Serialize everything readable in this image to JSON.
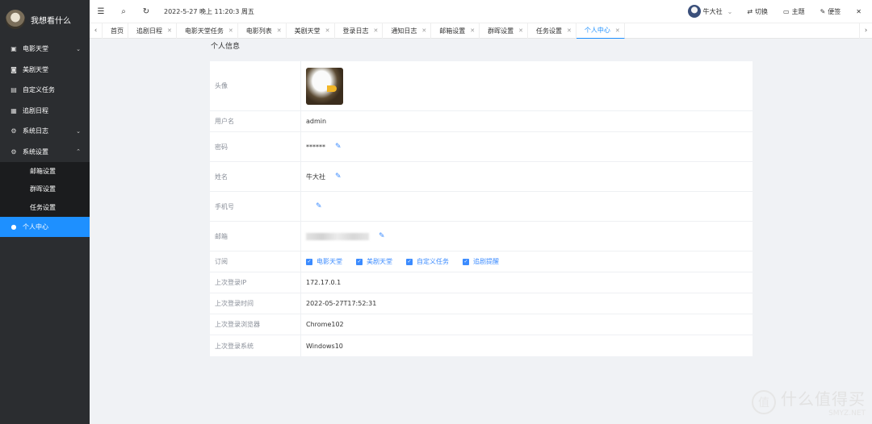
{
  "app": {
    "title": "我想看什么"
  },
  "sidebar": {
    "items": [
      {
        "label": "电影天堂",
        "icon": "film-icon",
        "chevron": "⌄"
      },
      {
        "label": "美剧天堂",
        "icon": "tv-icon",
        "chevron": ""
      },
      {
        "label": "自定义任务",
        "icon": "clipboard-icon",
        "chevron": ""
      },
      {
        "label": "追剧日程",
        "icon": "calendar-icon",
        "chevron": ""
      },
      {
        "label": "系统日志",
        "icon": "gear-icon",
        "chevron": "⌄"
      },
      {
        "label": "系统设置",
        "icon": "gear-icon",
        "chevron": "⌃"
      }
    ],
    "subitems": [
      {
        "label": "邮箱设置"
      },
      {
        "label": "群晖设置"
      },
      {
        "label": "任务设置"
      }
    ],
    "active": {
      "label": "个人中心",
      "icon": "user-icon"
    }
  },
  "topbar": {
    "menu_icon": "☰",
    "search_icon": "⌕",
    "refresh_icon": "↻",
    "datetime": "2022-5-27 晚上 11:20:3 周五",
    "user": "牛大社",
    "actions": {
      "switch": "切换",
      "theme": "主题",
      "notes": "便签"
    }
  },
  "tabs": [
    {
      "label": "首页",
      "closable": false
    },
    {
      "label": "追剧日程",
      "closable": true
    },
    {
      "label": "电影天堂任务",
      "closable": true
    },
    {
      "label": "电影列表",
      "closable": true
    },
    {
      "label": "美剧天堂",
      "closable": true
    },
    {
      "label": "登录日志",
      "closable": true
    },
    {
      "label": "通知日志",
      "closable": true
    },
    {
      "label": "邮箱设置",
      "closable": true
    },
    {
      "label": "群晖设置",
      "closable": true
    },
    {
      "label": "任务设置",
      "closable": true
    },
    {
      "label": "个人中心",
      "closable": true,
      "active": true
    }
  ],
  "page": {
    "title": "个人信息",
    "avatar_label": "头像",
    "username_label": "用户名",
    "username": "admin",
    "password_label": "密码",
    "password": "******",
    "name_label": "姓名",
    "name": "牛大社",
    "phone_label": "手机号",
    "email_label": "邮箱",
    "subscribe_label": "订阅",
    "subscriptions": [
      "电影天堂",
      "美剧天堂",
      "自定义任务",
      "追剧提醒"
    ],
    "ip_label": "上次登录IP",
    "ip": "172.17.0.1",
    "time_label": "上次登录时间",
    "time": "2022-05-27T17:52:31",
    "browser_label": "上次登录浏览器",
    "browser": "Chrome102",
    "os_label": "上次登录系统",
    "os": "Windows10"
  },
  "watermark": {
    "text": "什么值得买",
    "logo": "值",
    "sub": "SMYZ.NET"
  },
  "colors": {
    "accent": "#1e90ff",
    "sidebar": "#2b2d30"
  }
}
